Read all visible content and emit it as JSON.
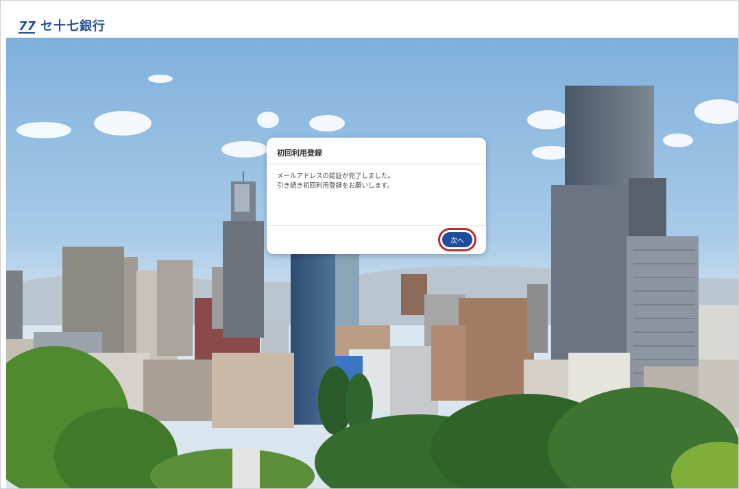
{
  "header": {
    "logo_mark_text": "77",
    "bank_name": "セ十七銀行"
  },
  "dialog": {
    "title": "初回利用登録",
    "message_line1": "メールアドレスの認証が完了しました。",
    "message_line2": "引き続き初回利用登録をお願いします。",
    "next_button_label": "次へ"
  },
  "colors": {
    "brand": "#1e4d9c",
    "highlight_ring": "#c0272d"
  }
}
